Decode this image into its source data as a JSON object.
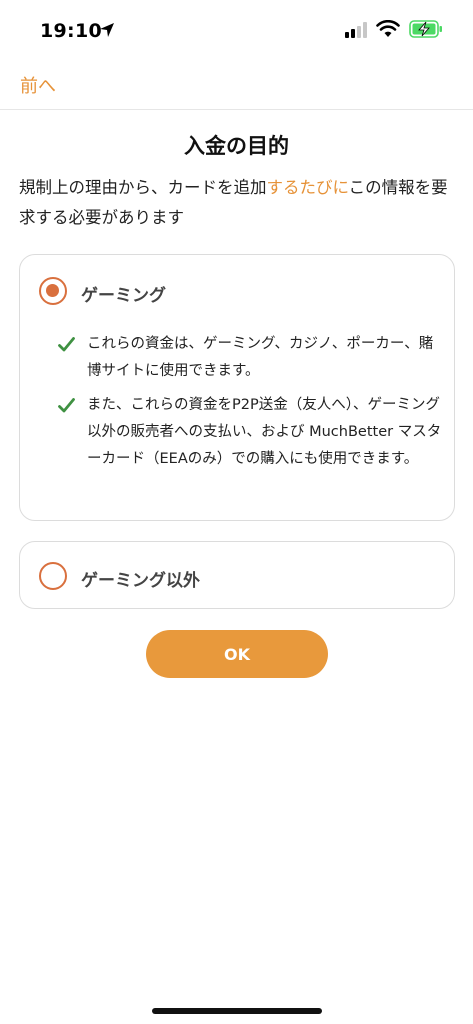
{
  "status_bar": {
    "time": "19:10",
    "icons": [
      "location-arrow-icon",
      "signal-bars-icon",
      "wifi-icon",
      "battery-charging-icon"
    ],
    "battery_color": "#4cd964"
  },
  "nav": {
    "back_label": "前へ"
  },
  "page": {
    "title": "入金の目的",
    "description_before": "規制上の理由から、カードを追加",
    "description_accent": "するたびに",
    "description_after": "この情報を要求する必要があります"
  },
  "options": {
    "gaming": {
      "label": "ゲーミング",
      "selected": true,
      "bullets": [
        "これらの資金は、ゲーミング、カジノ、ポーカー、賭博サイトに使用できます。",
        "また、これらの資金をP2P送金（友人へ）、ゲーミング以外の販売者への支払い、および MuchBetter マスターカード（EEAのみ）での購入にも使用できます。"
      ]
    },
    "non_gaming": {
      "label": "ゲーミング以外",
      "selected": false
    }
  },
  "ok_button": {
    "label": "OK"
  },
  "colors": {
    "accent": "#e69238",
    "radio": "#d9703e",
    "button": "#e8993c",
    "check": "#3f9142"
  }
}
